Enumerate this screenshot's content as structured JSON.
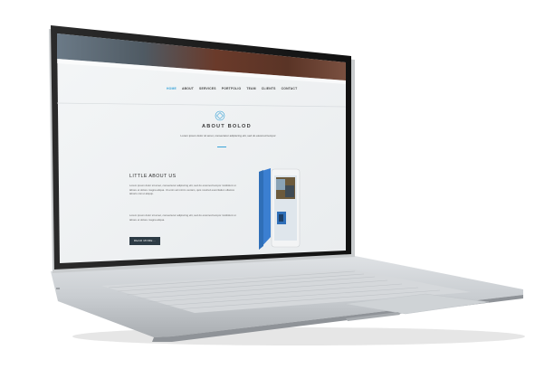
{
  "nav": {
    "items": [
      {
        "label": "HOME",
        "active": true
      },
      {
        "label": "ABOUT",
        "active": false
      },
      {
        "label": "SERVICES",
        "active": false
      },
      {
        "label": "PORTFOLIO",
        "active": false
      },
      {
        "label": "TEAM",
        "active": false
      },
      {
        "label": "CLIENTS",
        "active": false
      },
      {
        "label": "CONTACT",
        "active": false
      }
    ]
  },
  "about": {
    "title": "ABOUT BOLOD",
    "subtitle": "Lorem ipsum dolor sit amet, consectetur adipiscing elit, sed do eiusmod tempor"
  },
  "little_about": {
    "title": "LITTLE ABOUT US",
    "paragraph1": "Lorem ipsum dolor sit amet, consectetur adipiscing elit, sed do eiusmod tempor incididunt ut labore et dolore magna aliqua. Ut enim ad minim veniam, quis nostrud exercitation ullamco laboris nisi ut aliquip.",
    "paragraph2": "Lorem ipsum dolor sit amet, consectetur adipiscing elit, sed do eiusmod tempor incididunt ut labore et dolore magna aliqua.",
    "button": "READ MORE..."
  },
  "colors": {
    "accent": "#3aa4d8",
    "button_bg": "#2d3b45",
    "tablet_cover": "#3b7fd1"
  }
}
